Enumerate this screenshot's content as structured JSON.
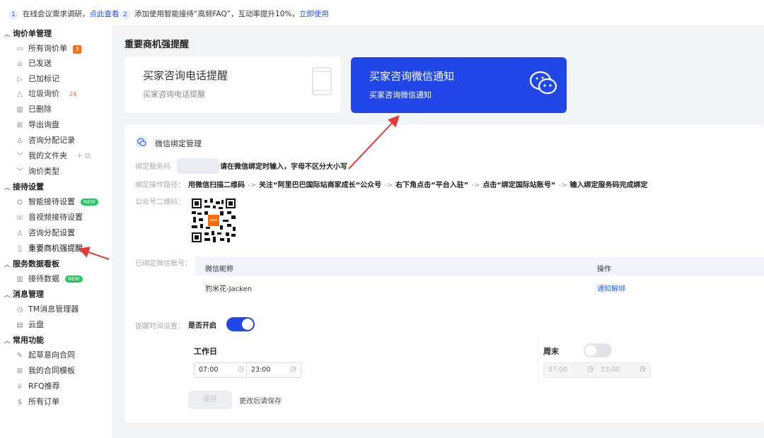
{
  "notice": {
    "n1": "1",
    "t1": "在线会议需求调研，",
    "l1": "点此查看",
    "n2": "2",
    "t2": "添加使用智能接待“高频FAQ”，互动率提升10%，",
    "l2": "立即使用"
  },
  "sidebar": {
    "g1": "询价单管理",
    "g1_items": [
      "所有询价单",
      "已发送",
      "已加标记",
      "垃圾询价",
      "已删除",
      "导出询盘",
      "咨询分配记录",
      "我的文件夹",
      "询价类型"
    ],
    "badge_all": "3",
    "badge_spam": "24",
    "g2": "接待设置",
    "g2_items": [
      "智能接待设置",
      "音视频接待设置",
      "咨询分配设置",
      "重要商机强提醒"
    ],
    "new_label": "NEW",
    "g3": "服务数据看板",
    "g3_items": [
      "接待数据"
    ],
    "g4": "消息管理",
    "g4_items": [
      "TM消息管理器",
      "云盘"
    ],
    "g5": "常用功能",
    "g5_items": [
      "起草意向合同",
      "我的合同模板",
      "RFQ推荐",
      "所有订单"
    ]
  },
  "page_title": "重要商机强提醒",
  "card_phone": {
    "title": "买家咨询电话提醒",
    "sub": "买家咨询电话提醒"
  },
  "card_wechat": {
    "title": "买家咨询微信通知",
    "sub": "买家咨询微信通知"
  },
  "panel": {
    "title": "微信绑定管理",
    "code_label": "绑定服务码",
    "code_hint": "请在微信绑定时输入，字母不区分大小写",
    "steps_label": "绑定操作路径：",
    "steps": [
      "用微信扫描二维码",
      "关注“阿里巴巴国际站商家成长“公众号",
      "右下角点击“平台入驻”",
      "点击“绑定国际站账号“",
      "输入绑定服务码完成绑定"
    ],
    "arrow": "->",
    "qr_label": "公众号二维码：",
    "bound_label": "已绑定微信账号：",
    "col_nick": "微信昵称",
    "col_op": "操作",
    "row_nick": "豹米花-Jacken",
    "row_op": "通知解绑",
    "remind_label": "提醒时间设置：",
    "enable_label": "是否开启",
    "workday": "工作日",
    "weekend": "周末",
    "wd_start": "07:00",
    "wd_end": "23:00",
    "we_start": "07:00",
    "we_end": "23:00",
    "save": "保存",
    "save_hint": "更改后请保存"
  },
  "colors": {
    "accent": "#2247e8",
    "link": "#1e4dff",
    "arrow": "#e53935"
  }
}
